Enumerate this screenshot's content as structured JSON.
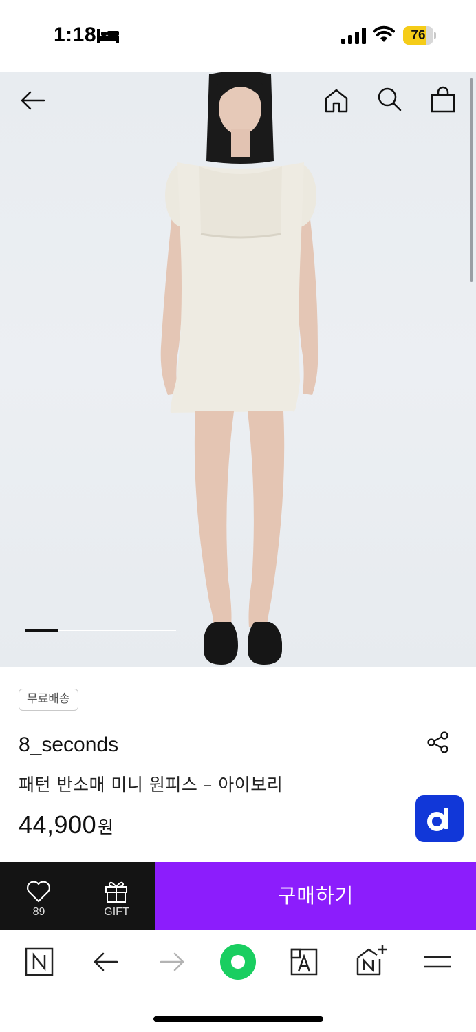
{
  "status_bar": {
    "time": "1:18",
    "battery_level": "76",
    "battery_fraction": 0.76,
    "icons": [
      "bed-icon",
      "cellular-signal-icon",
      "wifi-icon",
      "battery-icon"
    ]
  },
  "top_nav": {
    "icons": [
      "back-arrow-icon",
      "home-icon",
      "search-icon",
      "shopping-bag-icon"
    ]
  },
  "gallery": {
    "active_slide_fraction": 0.22
  },
  "product": {
    "badge": "무료배송",
    "brand": "8_seconds",
    "name": "패턴 반소매 미니 원피스 – 아이보리",
    "price": "44,900",
    "price_unit": "원"
  },
  "purchase_bar": {
    "like_count": "89",
    "gift_label": "GIFT",
    "buy_label": "구매하기",
    "colors": {
      "left_bg": "#141414",
      "buy_bg": "#8c1dfc"
    }
  },
  "floating": {
    "d_label": "d",
    "color": "#1137d8"
  },
  "browser_toolbar": {
    "icons": [
      "naver-n-icon",
      "back-arrow-icon",
      "forward-arrow-icon",
      "green-circle-icon",
      "translate-icon",
      "add-to-home-icon",
      "menu-icon"
    ],
    "accent": "#19ce60"
  }
}
